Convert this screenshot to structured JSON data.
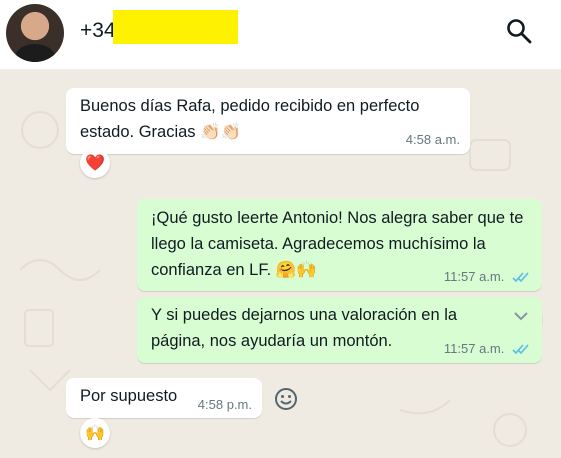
{
  "header": {
    "contact_name": "+34",
    "icons": {
      "search": "search-icon",
      "avatar": "avatar"
    }
  },
  "messages": [
    {
      "direction": "incoming",
      "text": "Buenos días Rafa, pedido recibido en perfecto estado. Gracias 👏🏻👏🏻",
      "time": "4:58 a.m.",
      "reaction": "❤️"
    },
    {
      "direction": "outgoing",
      "text": "¡Qué gusto leerte Antonio! Nos alegra saber que te llego la camiseta. Agradecemos muchísimo la confianza en LF. 🤗🙌",
      "time": "11:57 a.m.",
      "status": "read"
    },
    {
      "direction": "outgoing",
      "text": "Y si puedes dejarnos una valoración en la página, nos ayudaría un montón.",
      "time": "11:57 a.m.",
      "status": "read"
    },
    {
      "direction": "incoming",
      "text": "Por supuesto",
      "time": "4:58 p.m.",
      "reaction": "🙌"
    }
  ],
  "colors": {
    "background": "#efeae2",
    "incoming_bubble": "#ffffff",
    "outgoing_bubble": "#d9fdd3",
    "read_ticks": "#53bdeb",
    "timestamp": "#667781",
    "redaction": "#fff200"
  }
}
